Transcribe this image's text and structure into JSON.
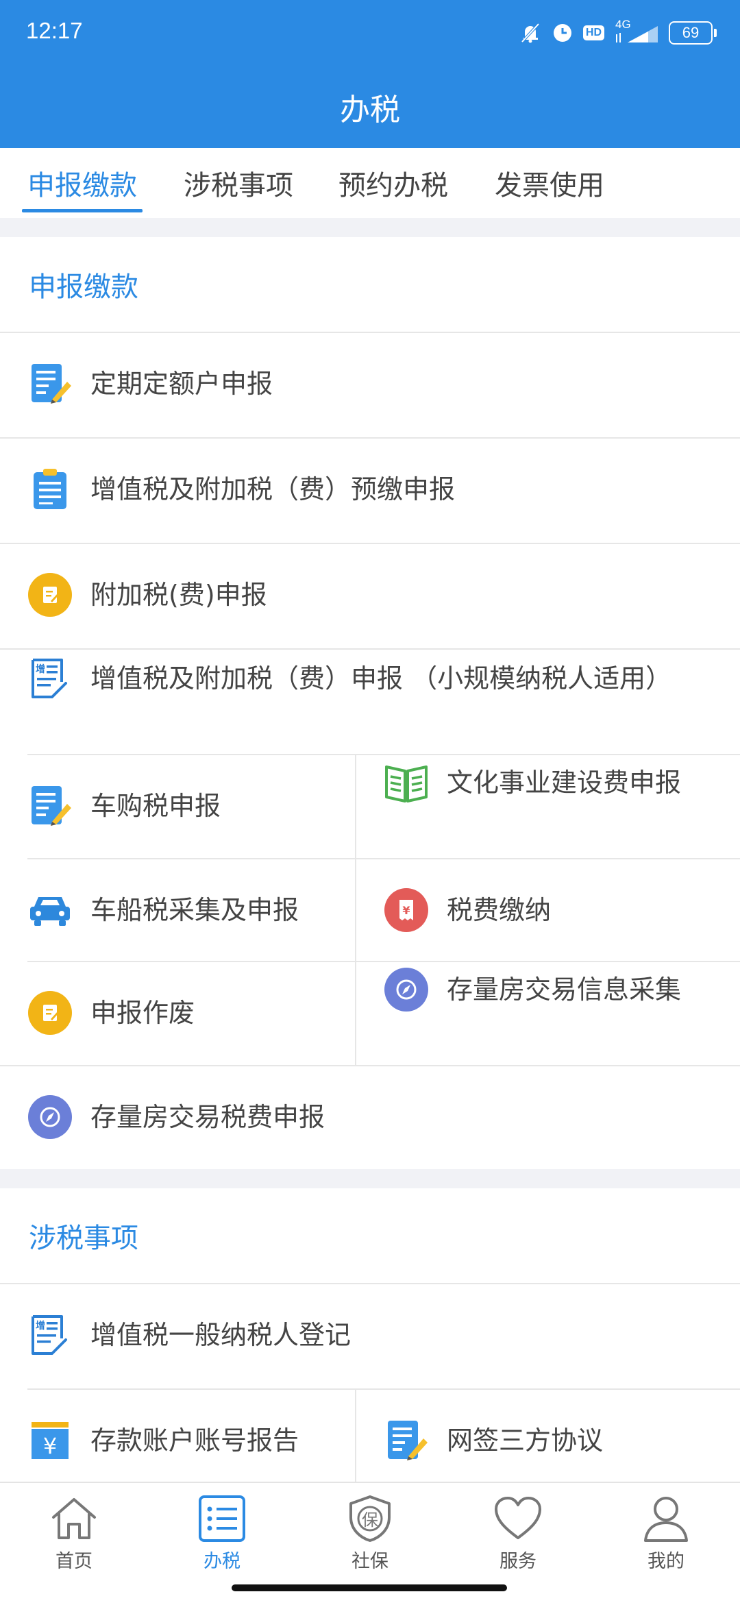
{
  "status_bar": {
    "time": "12:17",
    "network": "4G",
    "hd": "HD",
    "battery": "69"
  },
  "header": {
    "title": "办税"
  },
  "tabs": [
    {
      "label": "申报缴款",
      "active": true
    },
    {
      "label": "涉税事项",
      "active": false
    },
    {
      "label": "预约办税",
      "active": false
    },
    {
      "label": "发票使用",
      "active": false
    }
  ],
  "sections": {
    "declare": {
      "title": "申报缴款",
      "items": {
        "fixed_quota": {
          "label": "定期定额户申报",
          "icon": "edit-doc-icon"
        },
        "vat_prepay": {
          "label": "增值税及附加税（费）预缴申报",
          "icon": "clipboard-icon"
        },
        "surtax": {
          "label": "附加税(费)申报",
          "icon": "yellow-doc-icon"
        },
        "vat_small": {
          "label": "增值税及附加税（费）申报 （小规模纳税人适用）",
          "icon": "vat-form-icon"
        },
        "vehicle_purchase": {
          "label": "车购税申报",
          "icon": "edit-doc-icon"
        },
        "culture_fee": {
          "label": "文化事业建设费申报",
          "icon": "open-book-icon"
        },
        "vehicle_vessel": {
          "label": "车船税采集及申报",
          "icon": "car-icon"
        },
        "tax_payment": {
          "label": "税费缴纳",
          "icon": "yen-receipt-icon"
        },
        "void_declare": {
          "label": "申报作废",
          "icon": "yellow-doc-icon"
        },
        "house_info": {
          "label": "存量房交易信息采集",
          "icon": "compass-icon"
        },
        "house_tax": {
          "label": "存量房交易税费申报",
          "icon": "compass-icon"
        }
      }
    },
    "matters": {
      "title": "涉税事项",
      "items": {
        "vat_register": {
          "label": "增值税一般纳税人登记",
          "icon": "vat-form-icon"
        },
        "bank_account": {
          "label": "存款账户账号报告",
          "icon": "yen-card-icon"
        },
        "tripartite": {
          "label": "网签三方协议",
          "icon": "edit-doc-icon"
        }
      }
    }
  },
  "bottom_nav": [
    {
      "label": "首页",
      "icon": "home-icon",
      "active": false
    },
    {
      "label": "办税",
      "icon": "list-icon",
      "active": true
    },
    {
      "label": "社保",
      "icon": "shield-icon",
      "active": false
    },
    {
      "label": "服务",
      "icon": "heart-icon",
      "active": false
    },
    {
      "label": "我的",
      "icon": "person-icon",
      "active": false
    }
  ],
  "colors": {
    "primary": "#2b8ae3",
    "yellow": "#f2b416",
    "green": "#4caf50",
    "red": "#e35b58",
    "purple": "#6b7fd8"
  }
}
